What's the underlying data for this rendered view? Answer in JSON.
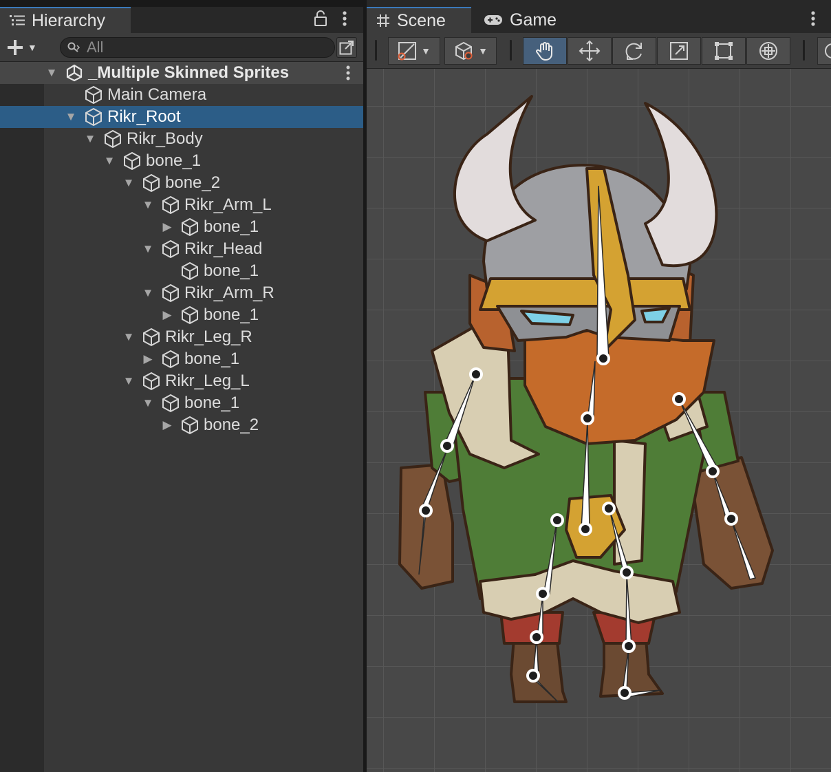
{
  "hierarchy": {
    "tab_label": "Hierarchy",
    "search_placeholder": "All",
    "scene_name": "_Multiple Skinned Sprites",
    "rows": [
      {
        "label": "Main Camera",
        "depth": 1,
        "arrow": "",
        "selected": false
      },
      {
        "label": "Rikr_Root",
        "depth": 1,
        "arrow": "expanded",
        "selected": true
      },
      {
        "label": "Rikr_Body",
        "depth": 2,
        "arrow": "expanded",
        "selected": false
      },
      {
        "label": "bone_1",
        "depth": 3,
        "arrow": "expanded",
        "selected": false
      },
      {
        "label": "bone_2",
        "depth": 4,
        "arrow": "expanded",
        "selected": false
      },
      {
        "label": "Rikr_Arm_L",
        "depth": 5,
        "arrow": "expanded",
        "selected": false
      },
      {
        "label": "bone_1",
        "depth": 6,
        "arrow": "collapsed",
        "selected": false
      },
      {
        "label": "Rikr_Head",
        "depth": 5,
        "arrow": "expanded",
        "selected": false
      },
      {
        "label": "bone_1",
        "depth": 6,
        "arrow": "",
        "selected": false
      },
      {
        "label": "Rikr_Arm_R",
        "depth": 5,
        "arrow": "expanded",
        "selected": false
      },
      {
        "label": "bone_1",
        "depth": 6,
        "arrow": "collapsed",
        "selected": false
      },
      {
        "label": "Rikr_Leg_R",
        "depth": 4,
        "arrow": "expanded",
        "selected": false
      },
      {
        "label": "bone_1",
        "depth": 5,
        "arrow": "collapsed",
        "selected": false
      },
      {
        "label": "Rikr_Leg_L",
        "depth": 4,
        "arrow": "expanded",
        "selected": false
      },
      {
        "label": "bone_1",
        "depth": 5,
        "arrow": "expanded",
        "selected": false
      },
      {
        "label": "bone_2",
        "depth": 6,
        "arrow": "collapsed",
        "selected": false
      }
    ]
  },
  "scene": {
    "tabs": [
      {
        "label": "Scene",
        "icon": "hash-icon",
        "active": true
      },
      {
        "label": "Game",
        "icon": "gamepad-icon",
        "active": false
      }
    ],
    "tools": [
      {
        "name": "draw-mode-dropdown",
        "icon": "draw-mode-icon"
      },
      {
        "name": "object-mode-dropdown",
        "icon": "cube-icon"
      },
      {
        "name": "hand-tool",
        "icon": "hand-icon",
        "active": true
      },
      {
        "name": "move-tool",
        "icon": "move-icon"
      },
      {
        "name": "rotate-tool",
        "icon": "rotate-icon"
      },
      {
        "name": "scale-tool",
        "icon": "scale-icon"
      },
      {
        "name": "rect-tool",
        "icon": "rect-icon"
      },
      {
        "name": "transform-tool",
        "icon": "transform-icon"
      }
    ]
  },
  "colors": {
    "accent": "#3a79bb",
    "selection": "#2c5d87",
    "panel_bg": "#383838",
    "viewport_bg": "#484848"
  }
}
